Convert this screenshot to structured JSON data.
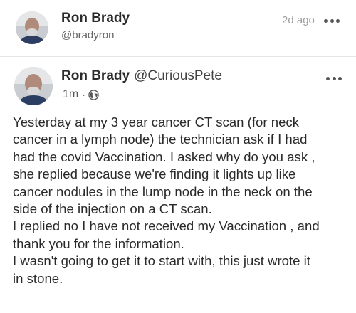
{
  "outer_post": {
    "author_name": "Ron Brady",
    "author_handle": "@bradyron",
    "timestamp": "2d ago",
    "more_icon": "ellipsis-horizontal-icon"
  },
  "inner_post": {
    "author_name": "Ron Brady",
    "author_handle": "@CuriousPete",
    "timestamp": "1m",
    "separator": "·",
    "visibility_icon": "globe-icon",
    "more_icon": "ellipsis-horizontal-icon",
    "body_lines": [
      "Yesterday at my 3 year cancer CT scan (for neck",
      "cancer in a lymph node) the technician ask if I had",
      "had the covid Vaccination. I asked why do you ask ,",
      "she replied because we're finding it lights up like",
      "cancer nodules in the lump node in the neck on the",
      "side of the injection on a CT scan.",
      "I replied no I have not received my Vaccination , and",
      "thank you for the information.",
      "I wasn't going to get it to start with, this just wrote it",
      "in stone."
    ]
  },
  "colors": {
    "name": "#2b2b2b",
    "handle": "#666666",
    "timestamp": "#a0a0a0",
    "body_text": "#2a2a2a",
    "divider": "#e6e6e6"
  }
}
